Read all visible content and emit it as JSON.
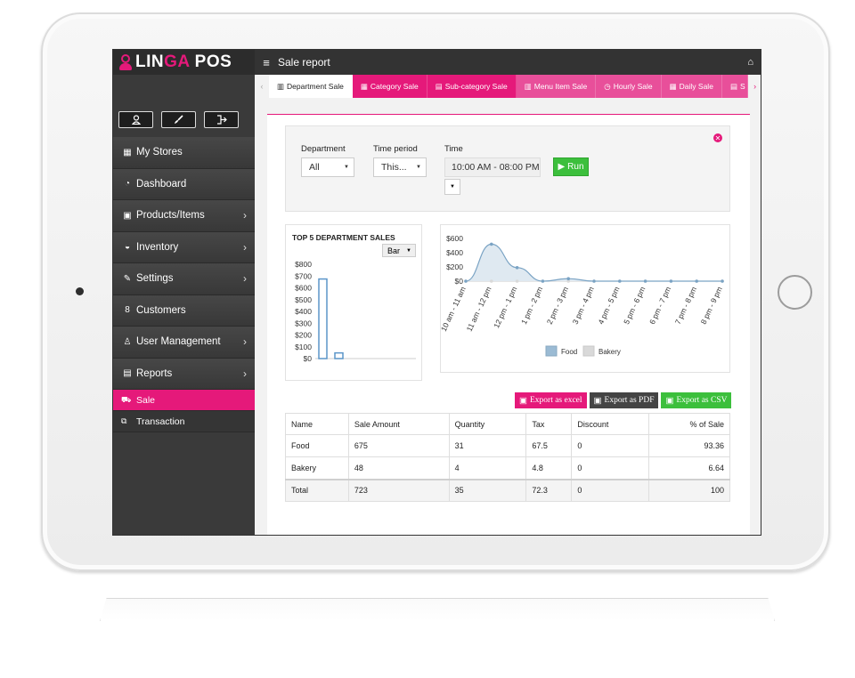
{
  "app": {
    "brand_pre": "LIN",
    "brand_mid": "GA",
    "brand_post": " POS",
    "page_title": "Sale report"
  },
  "sidebar": {
    "tools": [
      "user-icon",
      "brush-icon",
      "logout-icon"
    ],
    "items": [
      {
        "label": "My Stores",
        "icon": "store-icon",
        "chevron": false
      },
      {
        "label": "Dashboard",
        "icon": "dashboard-icon",
        "chevron": false
      },
      {
        "label": "Products/Items",
        "icon": "gift-icon",
        "chevron": true
      },
      {
        "label": "Inventory",
        "icon": "basket-icon",
        "chevron": true
      },
      {
        "label": "Settings",
        "icon": "wrench-icon",
        "chevron": true
      },
      {
        "label": "Customers",
        "icon": "customer-icon",
        "chevron": false
      },
      {
        "label": "User Management",
        "icon": "users-icon",
        "chevron": true
      },
      {
        "label": "Reports",
        "icon": "reports-icon",
        "chevron": true
      }
    ],
    "sub_items": [
      {
        "label": "Sale",
        "icon": "cart-icon",
        "active": true
      },
      {
        "label": "Transaction",
        "icon": "transaction-icon",
        "active": false
      }
    ]
  },
  "tabs": [
    {
      "label": "Department Sale",
      "icon": "building-icon",
      "active": true
    },
    {
      "label": "Category Sale",
      "icon": "grid-icon",
      "active": false
    },
    {
      "label": "Sub-category Sale",
      "icon": "list-icon",
      "active": false
    },
    {
      "label": "Menu Item Sale",
      "icon": "menu-icon",
      "active": false
    },
    {
      "label": "Hourly Sale",
      "icon": "clock-icon",
      "active": false
    },
    {
      "label": "Daily Sale",
      "icon": "calendar-icon",
      "active": false
    },
    {
      "label": "S",
      "icon": "doc-icon",
      "active": false
    }
  ],
  "filters": {
    "department_label": "Department",
    "department_value": "All",
    "period_label": "Time period",
    "period_value": "This...",
    "time_label": "Time",
    "time_value": "10:00 AM - 08:00 PM",
    "run_label": "Run"
  },
  "colors": {
    "accent": "#e5197a",
    "green": "#3cbf3c",
    "food": "#9bbbd4",
    "bakery": "#d9d9d9"
  },
  "chart_data": [
    {
      "type": "bar",
      "title": "TOP 5 DEPARTMENT SALES",
      "view_select": "Bar",
      "categories": [
        "Food",
        "Bakery"
      ],
      "values": [
        675,
        48
      ],
      "ylim": [
        0,
        800
      ],
      "yticks": [
        "$0",
        "$100",
        "$200",
        "$300",
        "$400",
        "$500",
        "$600",
        "$700",
        "$800"
      ]
    },
    {
      "type": "area",
      "x": [
        "10 am - 11 am",
        "11 am - 12 pm",
        "12 pm - 1 pm",
        "1 pm - 2 pm",
        "2 pm - 3 pm",
        "3 pm - 4 pm",
        "4 pm - 5 pm",
        "5 pm - 6 pm",
        "6 pm - 7 pm",
        "7 pm - 8 pm",
        "8 pm - 9 pm"
      ],
      "yticks": [
        "$0",
        "$200",
        "$400",
        "$600"
      ],
      "ylim": [
        0,
        600
      ],
      "series": [
        {
          "name": "Food",
          "values": [
            0,
            520,
            190,
            0,
            35,
            0,
            0,
            0,
            0,
            0,
            0
          ]
        },
        {
          "name": "Bakery",
          "values": [
            0,
            0,
            0,
            0,
            0,
            0,
            0,
            0,
            0,
            0,
            0
          ]
        }
      ],
      "legend": "bottom"
    }
  ],
  "exports": [
    {
      "label": "Export as excel",
      "icon": "excel-icon",
      "color": "pink"
    },
    {
      "label": "Export as PDF",
      "icon": "pdf-icon",
      "color": "dark"
    },
    {
      "label": "Export as CSV",
      "icon": "csv-icon",
      "color": "green"
    }
  ],
  "table": {
    "headers": [
      "Name",
      "Sale Amount",
      "Quantity",
      "Tax",
      "Discount",
      "% of Sale"
    ],
    "rows": [
      [
        "Food",
        "675",
        "31",
        "67.5",
        "0",
        "93.36"
      ],
      [
        "Bakery",
        "48",
        "4",
        "4.8",
        "0",
        "6.64"
      ]
    ],
    "total": [
      "Total",
      "723",
      "35",
      "72.3",
      "0",
      "100"
    ]
  }
}
